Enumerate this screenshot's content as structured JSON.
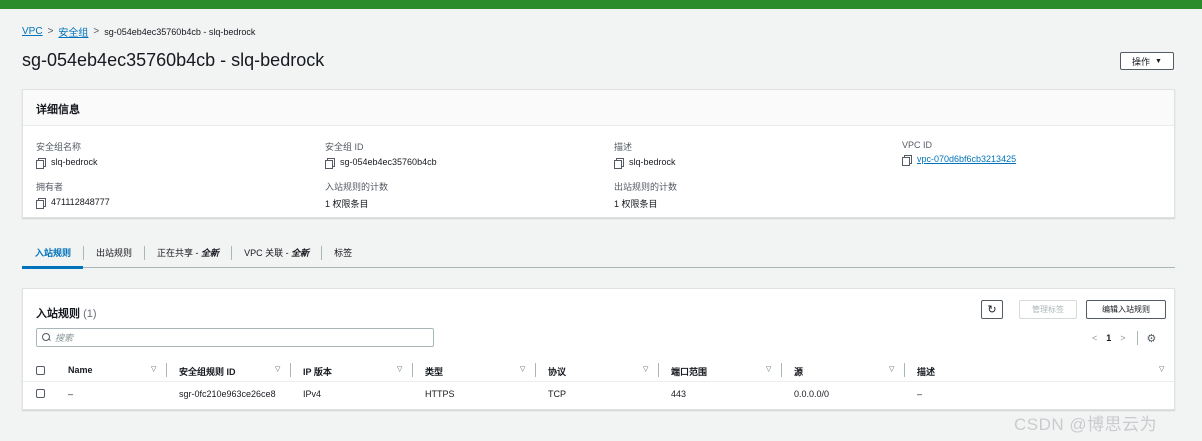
{
  "breadcrumb": {
    "vpc": "VPC",
    "security_groups": "安全组",
    "current": "sg-054eb4ec35760b4cb - slq-bedrock"
  },
  "page_title": "sg-054eb4ec35760b4cb - slq-bedrock",
  "actions_button": "操作",
  "details": {
    "header": "详细信息",
    "fields": [
      {
        "label": "安全组名称",
        "value": "slq-bedrock"
      },
      {
        "label": "安全组 ID",
        "value": "sg-054eb4ec35760b4cb"
      },
      {
        "label": "描述",
        "value": "slq-bedrock"
      },
      {
        "label": "VPC ID",
        "value": "vpc-070d6bf6cb3213425"
      },
      {
        "label": "拥有者",
        "value": "471112848777"
      },
      {
        "label": "入站规则的计数",
        "value": "1 权限条目"
      },
      {
        "label": "出站规则的计数",
        "value": "1 权限条目"
      }
    ]
  },
  "tabs": {
    "inbound": "入站规则",
    "outbound": "出站规则",
    "sharing": "正在共享 -",
    "sharing_new": "全新",
    "vpc_assoc": "VPC 关联 -",
    "vpc_assoc_new": "全新",
    "tags": "标签"
  },
  "inbound_rules": {
    "title": "入站规则",
    "count": "(1)",
    "manage_tags_button": "管理标签",
    "edit_button": "编辑入站规则",
    "search_placeholder": "搜索",
    "page": "1",
    "columns": {
      "name": "Name",
      "rule_id": "安全组规则 ID",
      "ip_version": "IP 版本",
      "type": "类型",
      "protocol": "协议",
      "port_range": "端口范围",
      "source": "源",
      "description": "描述"
    },
    "rows": [
      {
        "name": "–",
        "rule_id": "sgr-0fc210e963ce26ce8",
        "ip_version": "IPv4",
        "type": "HTTPS",
        "protocol": "TCP",
        "port_range": "443",
        "source": "0.0.0.0/0",
        "description": "–"
      }
    ]
  },
  "watermark": "CSDN @博思云为",
  "colors": {
    "top_bar": "#2a8c2a",
    "link": "#0073bb",
    "background": "#f2f3f3"
  }
}
